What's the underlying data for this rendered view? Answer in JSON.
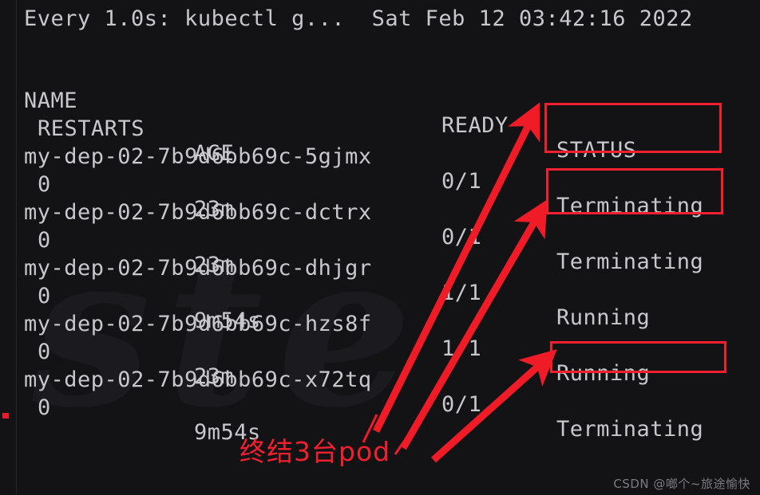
{
  "terminal": {
    "header": "Every 1.0s: kubectl g...  Sat Feb 12 03:42:16 2022",
    "columns_line1": {
      "name": "NAME",
      "ready": "READY",
      "status": "STATUS"
    },
    "columns_line2": {
      "restarts": "RESTARTS",
      "age": "AGE"
    },
    "rows": [
      {
        "name": "my-dep-02-7b9d6bb69c-5gjmx",
        "ready": "0/1",
        "status": "Terminating",
        "restarts": "0",
        "age": "23m"
      },
      {
        "name": "my-dep-02-7b9d6bb69c-dctrx",
        "ready": "0/1",
        "status": "Terminating",
        "restarts": "0",
        "age": "23m"
      },
      {
        "name": "my-dep-02-7b9d6bb69c-dhjgr",
        "ready": "1/1",
        "status": "Running",
        "restarts": "0",
        "age": "9m54s"
      },
      {
        "name": "my-dep-02-7b9d6bb69c-hzs8f",
        "ready": "1/1",
        "status": "Running",
        "restarts": "0",
        "age": "23m"
      },
      {
        "name": "my-dep-02-7b9d6bb69c-x72tq",
        "ready": "0/1",
        "status": "Terminating",
        "restarts": "0",
        "age": "9m54s"
      }
    ]
  },
  "annotations": {
    "note_text": "终结3台pod",
    "highlight_color": "#f2202e",
    "arrow_color": "#ef1b26"
  },
  "background": {
    "watermark_text": "ste",
    "terminal_bg": "#131316",
    "text_color": "#c7c7cc"
  },
  "footer": {
    "watermark": "CSDN @啷个~旅途愉快"
  }
}
